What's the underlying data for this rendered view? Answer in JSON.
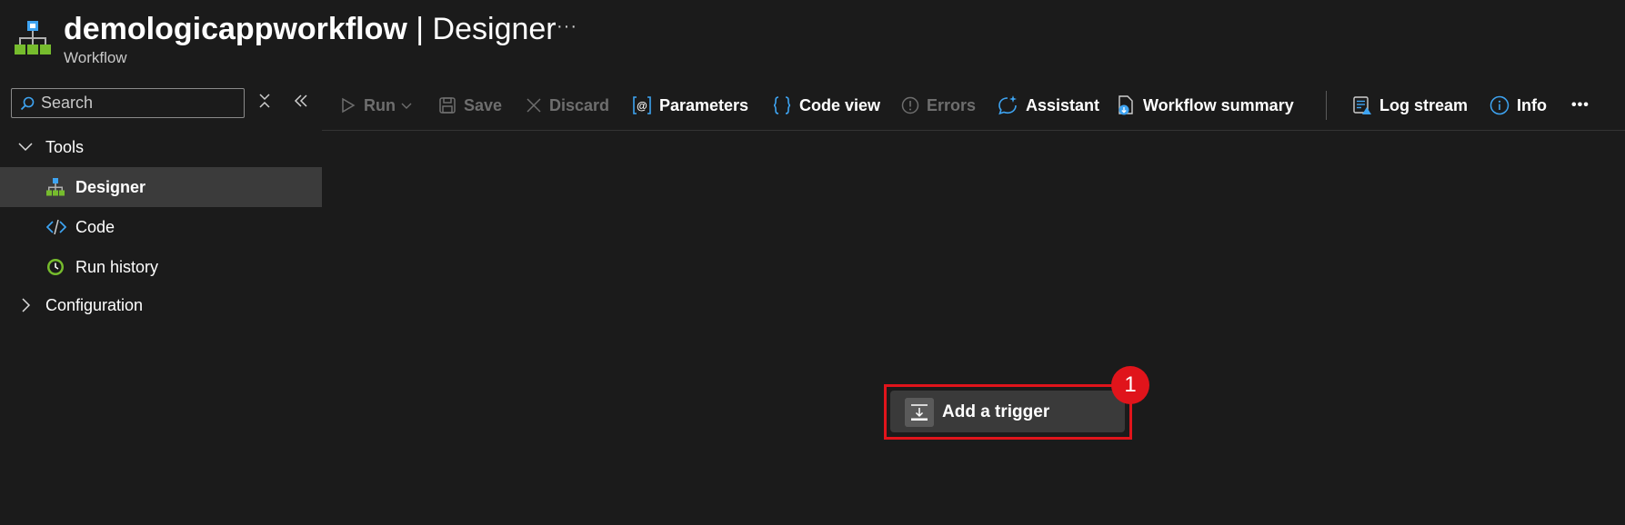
{
  "header": {
    "resource_name": "demologicappworkflow",
    "separator": " | ",
    "page_title": "Designer",
    "subtitle": "Workflow",
    "more_label": "···"
  },
  "sidebar": {
    "search": {
      "placeholder": "Search",
      "value": ""
    },
    "tree": [
      {
        "label": "Tools",
        "expanded": true
      },
      {
        "label": "Designer",
        "selected": true
      },
      {
        "label": "Code"
      },
      {
        "label": "Run history"
      },
      {
        "label": "Configuration",
        "expanded": false
      }
    ]
  },
  "toolbar": {
    "run": "Run",
    "save": "Save",
    "discard": "Discard",
    "parameters": "Parameters",
    "code_view": "Code view",
    "errors": "Errors",
    "assistant": "Assistant",
    "workflow_summary": "Workflow summary",
    "log_stream": "Log stream",
    "info": "Info",
    "more_label": "•••"
  },
  "canvas": {
    "add_trigger": "Add a trigger",
    "step_badge": "1"
  },
  "colors": {
    "background": "#1b1b1b",
    "selected_row": "#3b3b3b",
    "accent_blue": "#3ea4f2",
    "highlight_red": "#e0141b",
    "disabled_text": "#6e6e6e"
  }
}
